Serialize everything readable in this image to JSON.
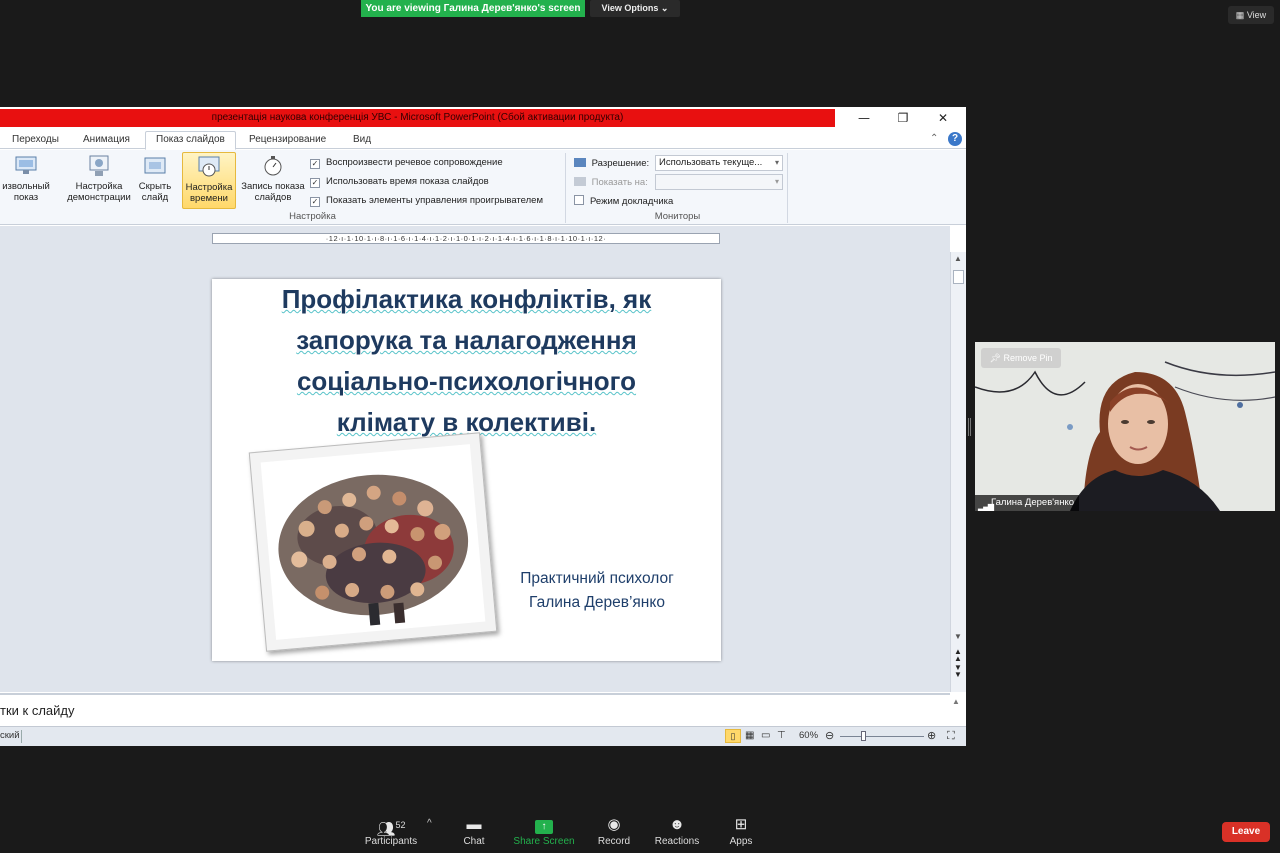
{
  "zoom": {
    "viewing_banner": "You are viewing Галина Дерев'янко's screen",
    "view_options": "View Options",
    "view_button": "View",
    "remove_pin": "Remove Pin",
    "participant_name": "Галина Дерев'янко",
    "participants_count": "52",
    "toolbar": {
      "participants": "Participants",
      "chat": "Chat",
      "share_screen": "Share Screen",
      "record": "Record",
      "reactions": "Reactions",
      "apps": "Apps",
      "leave": "Leave"
    },
    "colors": {
      "share_green": "#23b14d",
      "leave_red": "#d93127"
    }
  },
  "ppt": {
    "window_title": "презентація наукова конференція УВС  -  Microsoft PowerPoint (Сбой активации продукта)",
    "tabs": [
      "Переходы",
      "Анимация",
      "Показ слайдов",
      "Рецензирование",
      "Вид"
    ],
    "active_tab": "Показ слайдов",
    "ribbon": {
      "custom_show": "извольный\nпоказ",
      "setup_show": "Настройка\nдемонстрации",
      "hide_slide": "Скрыть\nслайд",
      "rehearse_timings": "Настройка\nвремени",
      "record_show": "Запись показа\nслайдов",
      "group_setup": "Настройка",
      "group_monitors": "Мониторы",
      "checkboxes": [
        {
          "label": "Воспроизвести речевое сопровождение",
          "checked": true
        },
        {
          "label": "Использовать время показа слайдов",
          "checked": true
        },
        {
          "label": "Показать элементы управления проигрывателем",
          "checked": true
        }
      ],
      "resolution_label": "Разрешение:",
      "resolution_value": "Использовать текуще...",
      "show_on_label": "Показать на:",
      "presenter_view": "Режим докладчика"
    },
    "ruler": "·12·ı·1·10·1·ı·8·ı·1·6·ı·1·4·ı·1·2·ı·1·0·1·ı·2·ı·1·4·ı·1·6·ı·1·8·ı·1·10·1·ı·12·",
    "slide": {
      "title_lines": [
        "Профілактика конфліктів, як",
        "запорука та налагодження",
        "соціально-психологічного",
        "клімату в колективі."
      ],
      "author_line1": "Практичний психолог",
      "author_line2": "Галина Дерев’янко"
    },
    "notes_text": "тки к слайду",
    "status_left": "ский",
    "zoom_level": "60%"
  }
}
